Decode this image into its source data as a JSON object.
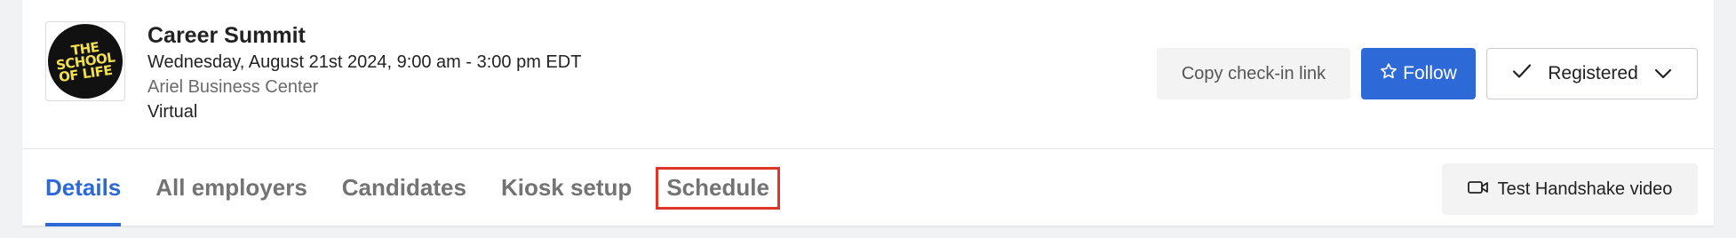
{
  "logo": {
    "lines": [
      "THE",
      "SCHOOL",
      "OF LIFE"
    ]
  },
  "event": {
    "title": "Career Summit",
    "date": "Wednesday, August 21st 2024, 9:00 am - 3:00 pm EDT",
    "location": "Ariel Business Center",
    "mode": "Virtual"
  },
  "actions": {
    "copy_label": "Copy check-in link",
    "follow_label": "Follow",
    "registered_label": "Registered"
  },
  "tabs": [
    {
      "label": "Details",
      "active": true
    },
    {
      "label": "All employers"
    },
    {
      "label": "Candidates"
    },
    {
      "label": "Kiosk setup"
    },
    {
      "label": "Schedule",
      "highlighted": true
    }
  ],
  "video_button": {
    "label": "Test Handshake video"
  },
  "colors": {
    "accent": "#2d6ad8",
    "highlight": "#e0352b",
    "logo_fg": "#f4e04d",
    "logo_bg": "#111111"
  },
  "icons": {
    "follow": "star-outline-icon",
    "registered": "checkmark-icon",
    "dropdown": "chevron-down-icon",
    "video": "video-camera-icon"
  }
}
